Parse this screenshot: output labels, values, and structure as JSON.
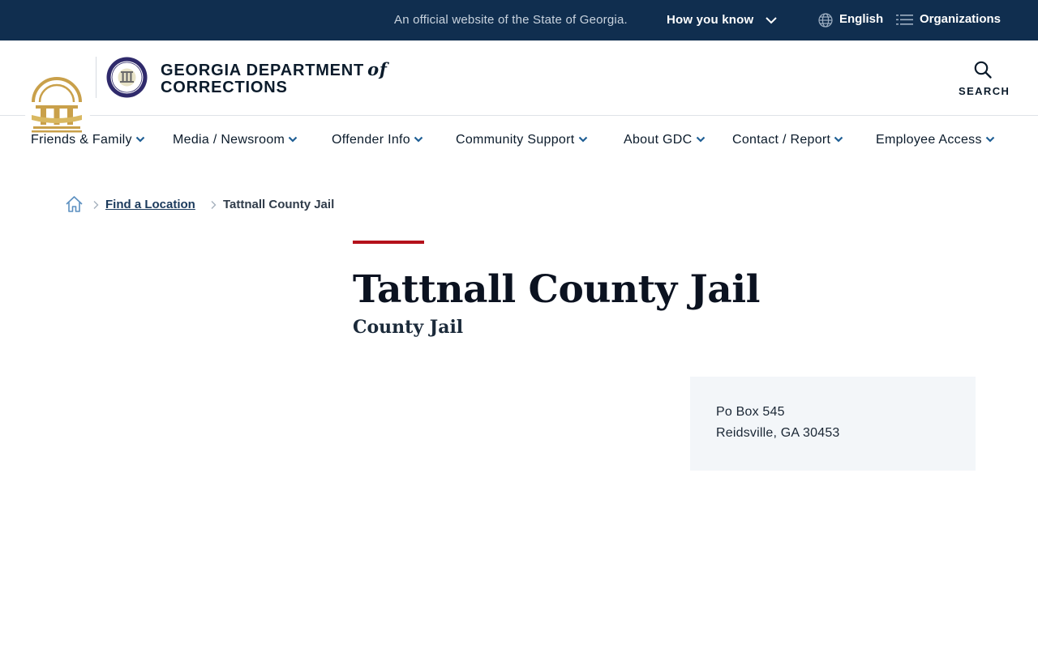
{
  "topbar": {
    "official_text": "An official website of the State of Georgia.",
    "how_you_know": "How you know",
    "language": "English",
    "organizations": "Organizations",
    "background_color": "#102e4f"
  },
  "header": {
    "dept_name_line1": "GEORGIA DEPARTMENT",
    "dept_name_of": "of",
    "dept_name_line2": "CORRECTIONS",
    "search_label": "SEARCH",
    "icons": [
      "georgia-state-seal-icon",
      "gdc-seal-icon",
      "search-icon"
    ]
  },
  "nav": {
    "items": [
      {
        "label": "Friends & Family"
      },
      {
        "label": "Media / Newsroom"
      },
      {
        "label": "Offender Info"
      },
      {
        "label": "Community Support"
      },
      {
        "label": "About GDC"
      },
      {
        "label": "Contact / Report"
      },
      {
        "label": "Employee Access"
      }
    ],
    "chevron_color": "#1f5e94"
  },
  "breadcrumb": {
    "home_icon": "home-icon",
    "link": "Find a Location",
    "current": "Tattnall County Jail"
  },
  "page": {
    "title": "Tattnall County Jail",
    "subtitle": "County Jail",
    "accent_color": "#b4111b"
  },
  "address": {
    "line1": "Po Box 545",
    "line2": "Reidsville, GA 30453"
  }
}
